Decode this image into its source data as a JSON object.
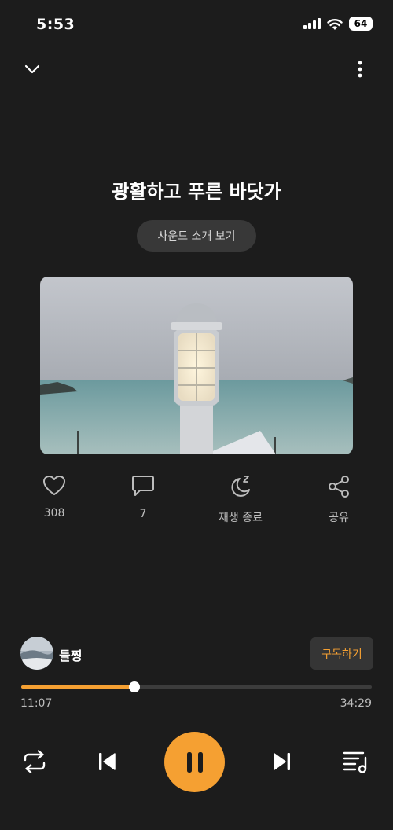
{
  "status_bar": {
    "time": "5:53",
    "battery": "64"
  },
  "track": {
    "title": "광활하고 푸른 바닷가",
    "intro_label": "사운드 소개 보기"
  },
  "actions": {
    "like_count": "308",
    "comment_count": "7",
    "sleep_timer_label": "재생 종료",
    "share_label": "공유"
  },
  "artist": {
    "name": "들찡",
    "subscribe_label": "구독하기"
  },
  "player": {
    "current_time": "11:07",
    "total_time": "34:29",
    "progress": 0.322
  },
  "colors": {
    "accent": "#f5a032",
    "background": "#1c1c1c"
  },
  "icons": [
    "chevron-down-icon",
    "more-vertical-icon",
    "heart-icon",
    "comment-icon",
    "moon-sleep-icon",
    "share-icon",
    "repeat-icon",
    "skip-previous-icon",
    "pause-icon",
    "skip-next-icon",
    "playlist-icon"
  ]
}
